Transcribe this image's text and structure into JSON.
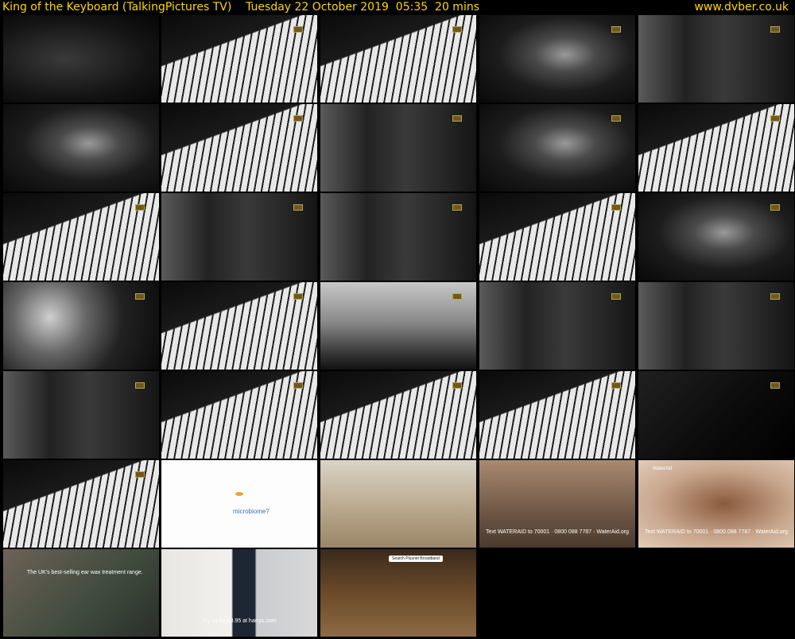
{
  "header": {
    "title": "King of the Keyboard (TalkingPictures TV)    Tuesday 22 October 2019  05:35  20 mins",
    "site": "www.dvber.co.uk"
  },
  "accent_color": "#ffd700",
  "thumbnails": [
    {
      "scene": "certificate",
      "style": "bw-cert",
      "badge": false
    },
    {
      "scene": "piano-keys",
      "style": "bw-keys",
      "badge": true
    },
    {
      "scene": "piano-keys",
      "style": "bw-keys",
      "badge": true
    },
    {
      "scene": "pianist-portrait",
      "style": "bw-man",
      "badge": true
    },
    {
      "scene": "room",
      "style": "bw-room",
      "badge": true
    },
    {
      "scene": "pianist",
      "style": "bw-man",
      "badge": false
    },
    {
      "scene": "piano-keys",
      "style": "bw-keys",
      "badge": true
    },
    {
      "scene": "pianist-plant",
      "style": "bw-room",
      "badge": true
    },
    {
      "scene": "pianist-portrait",
      "style": "bw-man",
      "badge": true
    },
    {
      "scene": "piano-keys",
      "style": "bw-keys",
      "badge": true
    },
    {
      "scene": "piano-keys",
      "style": "bw-keys",
      "badge": true
    },
    {
      "scene": "pianist-plant",
      "style": "bw-room",
      "badge": true
    },
    {
      "scene": "pianist-plant",
      "style": "bw-room",
      "badge": true
    },
    {
      "scene": "piano-keys",
      "style": "bw-keys",
      "badge": true
    },
    {
      "scene": "interviewer",
      "style": "bw-man",
      "badge": true
    },
    {
      "scene": "blossom",
      "style": "bw-plant",
      "badge": true
    },
    {
      "scene": "piano-keys",
      "style": "bw-keys",
      "badge": true
    },
    {
      "scene": "trees",
      "style": "bw-trees",
      "badge": true
    },
    {
      "scene": "interviewer-seated",
      "style": "bw-room",
      "badge": true
    },
    {
      "scene": "two-men",
      "style": "bw-room",
      "badge": true
    },
    {
      "scene": "pianist-plant",
      "style": "bw-room",
      "badge": true
    },
    {
      "scene": "piano-keys",
      "style": "bw-keys",
      "badge": true
    },
    {
      "scene": "piano-keys",
      "style": "bw-keys",
      "badge": true
    },
    {
      "scene": "piano-keys",
      "style": "bw-keys",
      "badge": true
    },
    {
      "scene": "dark-piano",
      "style": "bw-dark",
      "badge": true
    },
    {
      "scene": "piano-keys",
      "style": "bw-keys",
      "badge": true
    },
    {
      "scene": "microbiome-ad",
      "style": "ad-white",
      "badge": false,
      "text": "microbiome?"
    },
    {
      "scene": "field-ad",
      "style": "ad-field",
      "badge": false
    },
    {
      "scene": "wateraid-girl-ad",
      "style": "ad-girl",
      "badge": false,
      "text": "Text WATERAID to 70001 · 0800 088 7787 · WaterAid.org"
    },
    {
      "scene": "wateraid-boy-ad",
      "style": "ad-boy",
      "badge": false,
      "logo": "WaterAid",
      "text": "Text WATERAID to 70001 · 0800 088 7787 · WaterAid.org"
    },
    {
      "scene": "otex-ad",
      "style": "ad-otex",
      "badge": false,
      "text": "The UK's best-selling ear wax treatment range."
    },
    {
      "scene": "harrys-ad",
      "style": "ad-harry",
      "badge": false,
      "text": "Try us for £3.95 at harrys.com"
    },
    {
      "scene": "plusnet-ad",
      "style": "ad-sofa",
      "badge": false,
      "banner": "Search Plusnet Broadband"
    }
  ]
}
